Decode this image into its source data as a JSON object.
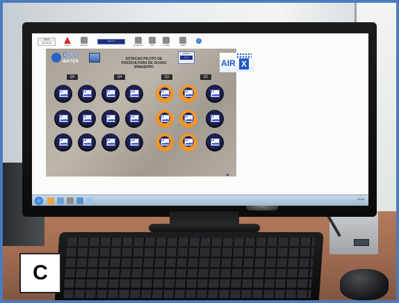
{
  "figure_label": "C",
  "app": {
    "toolbar": {
      "date_line1": "2012",
      "date_line2": "10:40:10",
      "status_text": "Sistema",
      "info_symbol": "i",
      "items": [
        {
          "label": "Alarme",
          "color": "#d32a2a"
        },
        {
          "label": "Historico",
          "color": "#8a8a8a"
        },
        {
          "label": "Relatorios",
          "color": "#8a8a8a"
        },
        {
          "label": "Sair",
          "color": "#8a8a8a"
        },
        {
          "label": "Config",
          "color": "#8a8a8a"
        },
        {
          "label": "Ajuda",
          "color": "#8a8a8a"
        }
      ]
    },
    "logo": {
      "brand": "B&G",
      "sub": "WATER"
    },
    "title": "ESTACAO PILOTO DE PISCICULTURA DE OLHAO IPMA/EPPO",
    "mode": {
      "label": "MODO",
      "value": "0.5"
    },
    "airx": {
      "left": "AIR",
      "right": "X"
    },
    "groups": [
      "Q5",
      "Q4",
      "Q2",
      "Q1"
    ],
    "tanks": [
      {
        "id": "L1",
        "value": "4.5",
        "alert": false
      },
      {
        "id": "L4",
        "value": "4.5",
        "alert": false
      },
      {
        "id": "L7",
        "value": "4.5",
        "alert": false
      },
      {
        "id": "L10",
        "value": "4.5",
        "alert": false
      },
      {
        "id": "L1",
        "value": "4.5",
        "alert": true
      },
      {
        "id": "L4",
        "value": "4.5",
        "alert": true
      },
      {
        "id": "L1",
        "value": "4.5",
        "alert": false
      },
      {
        "id": "L2",
        "value": "4.5",
        "alert": false
      },
      {
        "id": "L5",
        "value": "4.5",
        "alert": false
      },
      {
        "id": "L8",
        "value": "4.5",
        "alert": false
      },
      {
        "id": "L11",
        "value": "4.5",
        "alert": false
      },
      {
        "id": "L2",
        "value": "4.5",
        "alert": true
      },
      {
        "id": "L5",
        "value": "4.5",
        "alert": true
      },
      {
        "id": "L2",
        "value": "4.5",
        "alert": false
      },
      {
        "id": "L3",
        "value": "4.5",
        "alert": false
      },
      {
        "id": "L6",
        "value": "4.5",
        "alert": false
      },
      {
        "id": "L9",
        "value": "4.5",
        "alert": false
      },
      {
        "id": "L12",
        "value": "4.5",
        "alert": false
      },
      {
        "id": "L3",
        "value": "4.5",
        "alert": true
      },
      {
        "id": "L6",
        "value": "4.5",
        "alert": true
      },
      {
        "id": "L3",
        "value": "4.5",
        "alert": false
      }
    ],
    "taskbar": {
      "tray_text": "10:40"
    }
  },
  "colors": {
    "frame_border": "#4a7bbf",
    "tank_dark": "#1d1f4d",
    "tank_alert": "#f19a2e",
    "brand_blue": "#1e57c4"
  }
}
